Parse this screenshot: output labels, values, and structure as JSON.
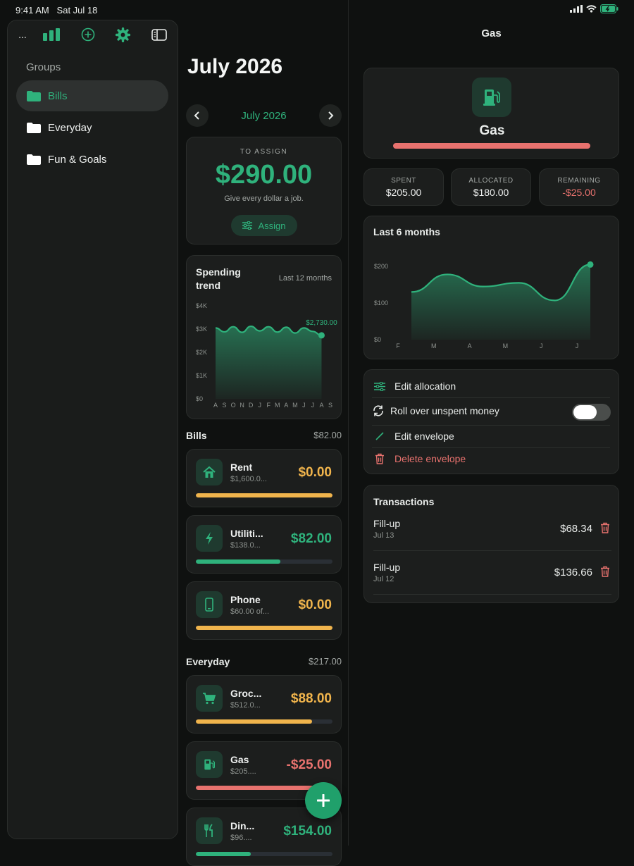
{
  "status": {
    "time": "9:41 AM",
    "date": "Sat Jul 18"
  },
  "sidebar": {
    "more_label": "...",
    "groups_title": "Groups",
    "items": [
      {
        "label": "Bills",
        "active": true
      },
      {
        "label": "Everyday",
        "active": false
      },
      {
        "label": "Fun & Goals",
        "active": false
      }
    ]
  },
  "main": {
    "title": "July 2026",
    "month_label": "July 2026",
    "to_assign": {
      "key": "TO ASSIGN",
      "amount": "$290.00",
      "subtitle": "Give every dollar a job.",
      "button": "Assign"
    },
    "trend": {
      "title": "Spending trend",
      "range": "Last 12 months",
      "value_label": "$2,730.00"
    },
    "sections": [
      {
        "name": "Bills",
        "total": "$82.00"
      },
      {
        "name": "Everyday",
        "total": "$217.00"
      }
    ],
    "envelopes": [
      {
        "name": "Rent",
        "sub": "$1,600.0...",
        "value": "$0.00",
        "icon": "house-icon",
        "fill": 1.0,
        "color": "#f0b44c"
      },
      {
        "name": "Utiliti...",
        "sub": "$138.0...",
        "value": "$82.00",
        "icon": "bolt-icon",
        "fill": 0.62,
        "color": "#2fb27c"
      },
      {
        "name": "Phone",
        "sub": "$60.00 of...",
        "value": "$0.00",
        "icon": "phone-icon",
        "fill": 1.0,
        "color": "#f0b44c"
      },
      {
        "name": "Groc...",
        "sub": "$512.0...",
        "value": "$88.00",
        "icon": "cart-icon",
        "fill": 0.85,
        "color": "#f0b44c"
      },
      {
        "name": "Gas",
        "sub": "$205....",
        "value": "-$25.00",
        "icon": "gas-pump-icon",
        "fill": 1.0,
        "color": "#e8726e"
      },
      {
        "name": "Din...",
        "sub": "$96....",
        "value": "$154.00",
        "icon": "fork-knife-icon",
        "fill": 0.4,
        "color": "#2fb27c"
      }
    ]
  },
  "detail": {
    "nav_title": "Gas",
    "name": "Gas",
    "icon": "gas-pump-icon",
    "stats": [
      {
        "key": "SPENT",
        "value": "$205.00",
        "color": "#eef0ef"
      },
      {
        "key": "ALLOCATED",
        "value": "$180.00",
        "color": "#eef0ef"
      },
      {
        "key": "REMAINING",
        "value": "-$25.00",
        "color": "#e8726e"
      }
    ],
    "history_title": "Last 6 months",
    "actions": {
      "edit_allocation": "Edit allocation",
      "roll_over": "Roll over unspent money",
      "edit_envelope": "Edit envelope",
      "delete_envelope": "Delete envelope"
    },
    "rollover_enabled": false,
    "transactions_title": "Transactions",
    "transactions": [
      {
        "name": "Fill-up",
        "date": "Jul 13",
        "amount": "$68.34"
      },
      {
        "name": "Fill-up",
        "date": "Jul 12",
        "amount": "$136.66"
      }
    ]
  },
  "colors": {
    "accent": "#2fb27c",
    "warning": "#f0b44c",
    "danger": "#e8726e"
  },
  "chart_data": [
    {
      "type": "area",
      "title": "Spending trend",
      "categories": [
        "A",
        "S",
        "O",
        "N",
        "D",
        "J",
        "F",
        "M",
        "A",
        "M",
        "J",
        "J",
        "A",
        "S"
      ],
      "values": [
        3050,
        2880,
        3100,
        2860,
        3120,
        2920,
        3100,
        2870,
        3080,
        2830,
        3050,
        2900,
        2730,
        null
      ],
      "yticks": [
        "$4K",
        "$3K",
        "$2K",
        "$1K",
        "$0"
      ],
      "ylim": [
        0,
        4000
      ]
    },
    {
      "type": "area",
      "title": "Last 6 months",
      "categories": [
        "F",
        "M",
        "A",
        "M",
        "J",
        "J"
      ],
      "values": [
        130,
        178,
        145,
        155,
        107,
        205
      ],
      "yticks": [
        "$200",
        "$100",
        "$0"
      ],
      "ylim": [
        0,
        200
      ]
    }
  ]
}
